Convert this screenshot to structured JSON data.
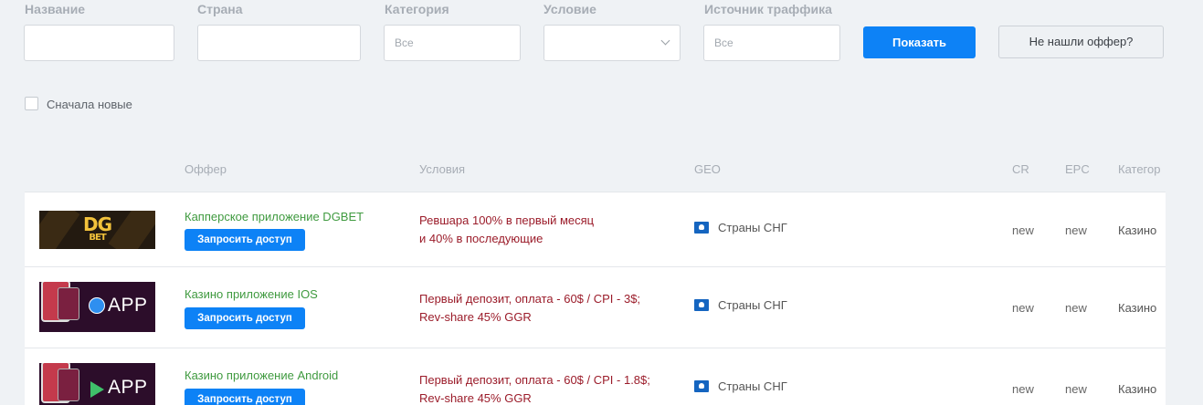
{
  "filters": {
    "name": {
      "label": "Название",
      "value": ""
    },
    "country": {
      "label": "Страна",
      "value": ""
    },
    "category": {
      "label": "Категория",
      "placeholder": "Все"
    },
    "condition": {
      "label": "Условие",
      "value": ""
    },
    "traffic_source": {
      "label": "Источник траффика",
      "placeholder": "Все"
    },
    "show_button": "Показать",
    "not_found_button": "Не нашли оффер?",
    "newest_first_label": "Сначала новые"
  },
  "table": {
    "headers": {
      "offer": "Оффер",
      "conditions": "Условия",
      "geo": "GEO",
      "cr": "CR",
      "epc": "EPC",
      "category": "Категор"
    },
    "rows": [
      {
        "name": "Капперское приложение DGBET",
        "request_label": "Запросить доступ",
        "conditions": [
          "Ревшара 100% в первый месяц",
          "и 40% в последующие"
        ],
        "geo": "Страны СНГ",
        "cr": "new",
        "epc": "new",
        "category": "Казино",
        "logo_text": "DG",
        "logo_subtext": "BET"
      },
      {
        "name": "Казино приложение IOS",
        "request_label": "Запросить доступ",
        "conditions": [
          "Первый депозит, оплата - 60$ / CPI - 3$;",
          "Rev-share 45% GGR"
        ],
        "geo": "Страны СНГ",
        "cr": "new",
        "epc": "new",
        "category": "Казино",
        "logo_text": "APP"
      },
      {
        "name": "Казино приложение Android",
        "request_label": "Запросить доступ",
        "conditions": [
          "Первый депозит, оплата - 60$ / CPI - 1.8$;",
          "Rev-share 45% GGR"
        ],
        "geo": "Страны СНГ",
        "cr": "new",
        "epc": "new",
        "category": "Казино",
        "logo_text": "APP"
      }
    ]
  },
  "colors": {
    "primary": "#0d82f6",
    "offer_name": "#3f9a3f",
    "conditions": "#9b1c2a",
    "background": "#eff2f5"
  }
}
